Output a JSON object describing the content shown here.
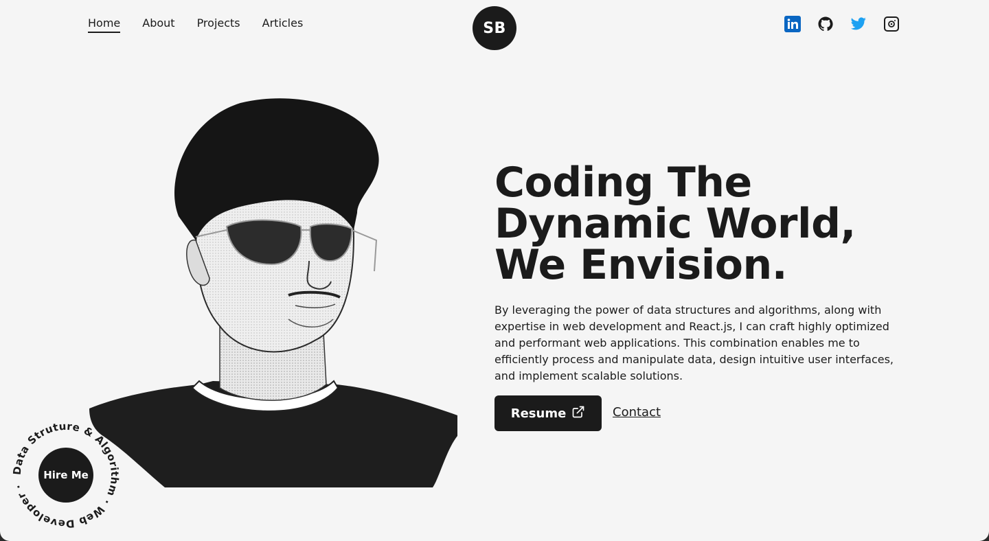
{
  "nav": {
    "items": [
      {
        "label": "Home",
        "active": true
      },
      {
        "label": "About"
      },
      {
        "label": "Projects"
      },
      {
        "label": "Articles"
      }
    ]
  },
  "logo": {
    "text": "SB"
  },
  "social": [
    {
      "icon": "linkedin-icon",
      "color": "#0a66c2"
    },
    {
      "icon": "github-icon",
      "color": "#1b1b1b"
    },
    {
      "icon": "twitter-icon",
      "color": "#1da1f2"
    },
    {
      "icon": "dribbble-icon",
      "color": "#1b1b1b"
    }
  ],
  "hero": {
    "headline": [
      "Coding The",
      "Dynamic World,",
      "We Envision."
    ],
    "description": "By leveraging the power of data structures and algorithms, along with expertise in web development and React.js, I can craft highly optimized and performant web applications. This combination enables me to efficiently process and manipulate data, design intuitive user interfaces, and implement scalable solutions.",
    "resume_label": "Resume",
    "contact_label": "Contact"
  },
  "hire": {
    "label": "Hire Me",
    "ring_text": "Data Struture & Algorithm · Web Developer ·"
  },
  "colors": {
    "background": "#f5f5f5",
    "dark": "#1b1b1b"
  }
}
